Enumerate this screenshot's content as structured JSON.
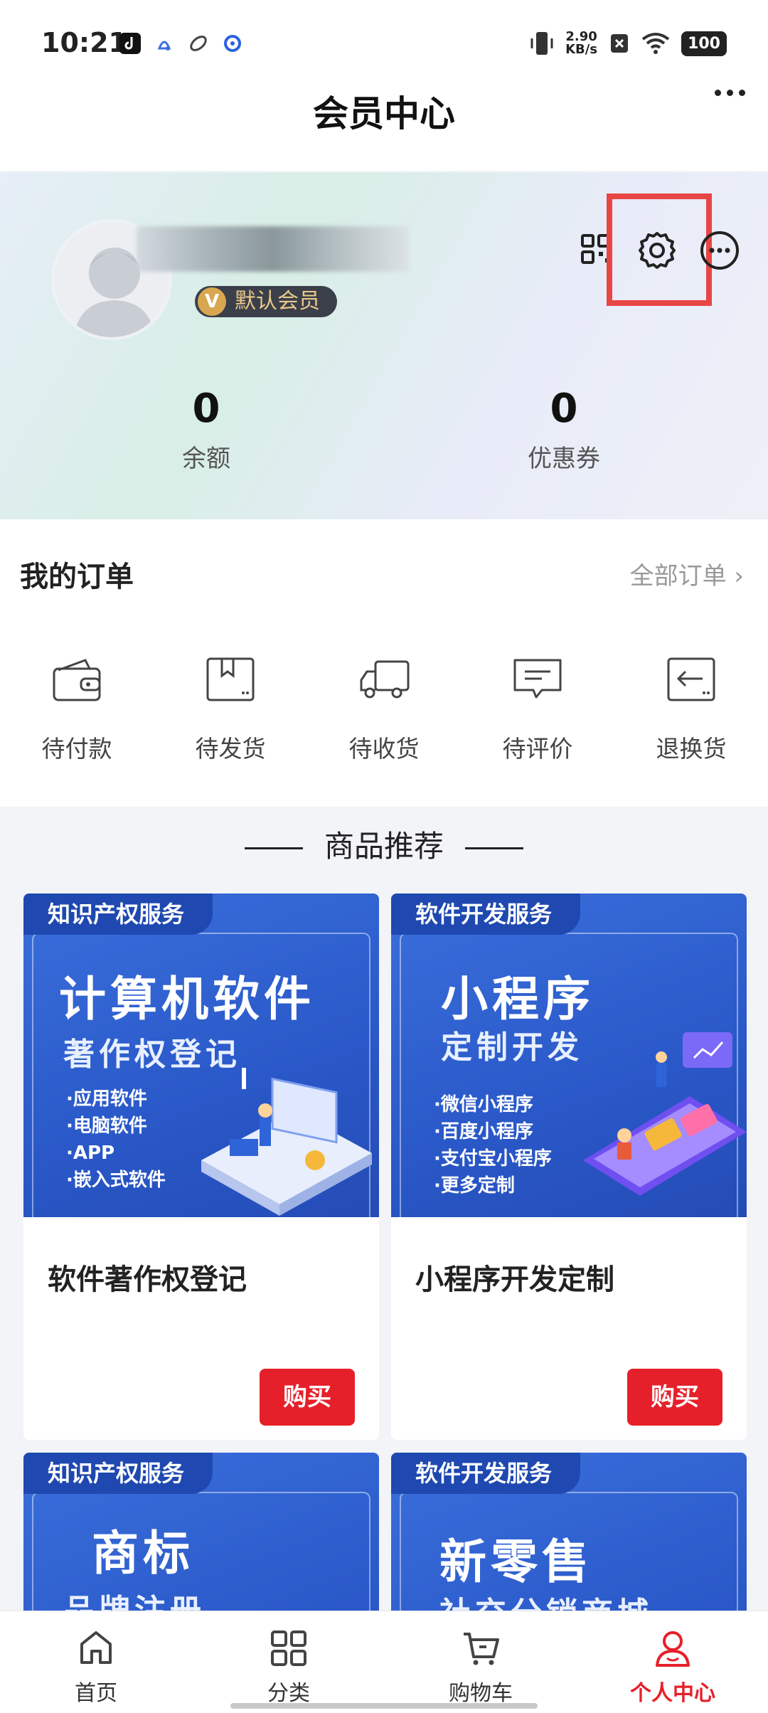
{
  "status_bar": {
    "time": "10:21",
    "net_speed_value": "2.90",
    "net_speed_unit": "KB/s",
    "battery": "100"
  },
  "header": {
    "title": "会员中心"
  },
  "profile": {
    "member_level": "默认会员",
    "stats": [
      {
        "value": "0",
        "label": "余额"
      },
      {
        "value": "0",
        "label": "优惠券"
      }
    ]
  },
  "orders": {
    "title": "我的订单",
    "all_label": "全部订单 ›",
    "items": [
      {
        "label": "待付款",
        "icon": "wallet-icon"
      },
      {
        "label": "待发货",
        "icon": "package-icon"
      },
      {
        "label": "待收货",
        "icon": "truck-icon"
      },
      {
        "label": "待评价",
        "icon": "comment-icon"
      },
      {
        "label": "退换货",
        "icon": "return-icon"
      }
    ]
  },
  "recommend": {
    "title": "商品推荐",
    "products": [
      {
        "tag": "知识产权服务",
        "banner_title": "计算机软件",
        "banner_subtitle": "著作权登记",
        "bullets": [
          "·应用软件",
          "·电脑软件",
          "·APP",
          "·嵌入式软件"
        ],
        "name": "软件著作权登记",
        "buy_label": "购买"
      },
      {
        "tag": "软件开发服务",
        "banner_title": "小程序",
        "banner_subtitle": "定制开发",
        "bullets": [
          "·微信小程序",
          "·百度小程序",
          "·支付宝小程序",
          "·更多定制"
        ],
        "name": "小程序开发定制",
        "buy_label": "购买"
      },
      {
        "tag": "知识产权服务",
        "banner_title": "商标",
        "banner_subtitle": "品牌注册"
      },
      {
        "tag": "软件开发服务",
        "banner_title": "新零售",
        "banner_subtitle": "社交分销商城"
      }
    ]
  },
  "tabbar": {
    "tabs": [
      {
        "label": "首页",
        "icon": "home-icon"
      },
      {
        "label": "分类",
        "icon": "category-grid-icon"
      },
      {
        "label": "购物车",
        "icon": "cart-icon"
      },
      {
        "label": "个人中心",
        "icon": "user-icon"
      }
    ],
    "active_color": "#e6202a"
  }
}
